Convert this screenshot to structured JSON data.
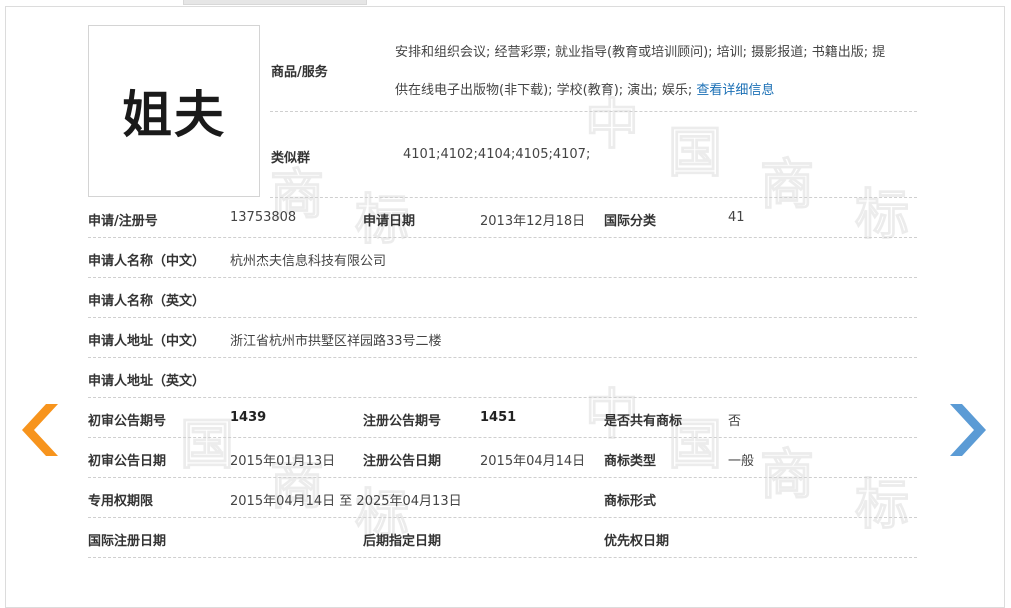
{
  "trademark": {
    "logo_text": "姐夫"
  },
  "goods": {
    "label": "商品/服务",
    "line1": "安排和组织会议; 经营彩票; 就业指导(教育或培训顾问); 培训; 摄影报道; 书籍出版; 提",
    "line2": "供在线电子出版物(非下载); 学校(教育); 演出; 娱乐;",
    "detail_link": "查看详细信息"
  },
  "similar_group": {
    "label": "类似群",
    "value": "4101;4102;4104;4105;4107;"
  },
  "rows": {
    "reg_no": {
      "label": "申请/注册号",
      "value": "13753808"
    },
    "app_date": {
      "label": "申请日期",
      "value": "2013年12月18日"
    },
    "intl_class": {
      "label": "国际分类",
      "value": "41"
    },
    "applicant_cn": {
      "label": "申请人名称（中文）",
      "value": "杭州杰夫信息科技有限公司"
    },
    "applicant_en": {
      "label": "申请人名称（英文）",
      "value": ""
    },
    "address_cn": {
      "label": "申请人地址（中文）",
      "value": "浙江省杭州市拱墅区祥园路33号二楼"
    },
    "address_en": {
      "label": "申请人地址（英文）",
      "value": ""
    },
    "prelim_issue": {
      "label": "初审公告期号",
      "value": "1439"
    },
    "reg_issue": {
      "label": "注册公告期号",
      "value": "1451"
    },
    "shared": {
      "label": "是否共有商标",
      "value": "否"
    },
    "prelim_date": {
      "label": "初审公告日期",
      "value": "2015年01月13日"
    },
    "reg_date": {
      "label": "注册公告日期",
      "value": "2015年04月14日"
    },
    "tm_type": {
      "label": "商标类型",
      "value": "一般"
    },
    "exclusive_period": {
      "label": "专用权期限",
      "value": "2015年04月14日 至 2025年04月13日"
    },
    "tm_form": {
      "label": "商标形式",
      "value": ""
    },
    "intl_reg_date": {
      "label": "国际注册日期",
      "value": ""
    },
    "later_designation": {
      "label": "后期指定日期",
      "value": ""
    },
    "priority_date": {
      "label": "优先权日期",
      "value": ""
    }
  },
  "nav": {
    "prev_icon": "arrow-left-icon",
    "next_icon": "arrow-right-icon",
    "prev_color": "#f7941d",
    "next_color": "#5b9bd5"
  }
}
